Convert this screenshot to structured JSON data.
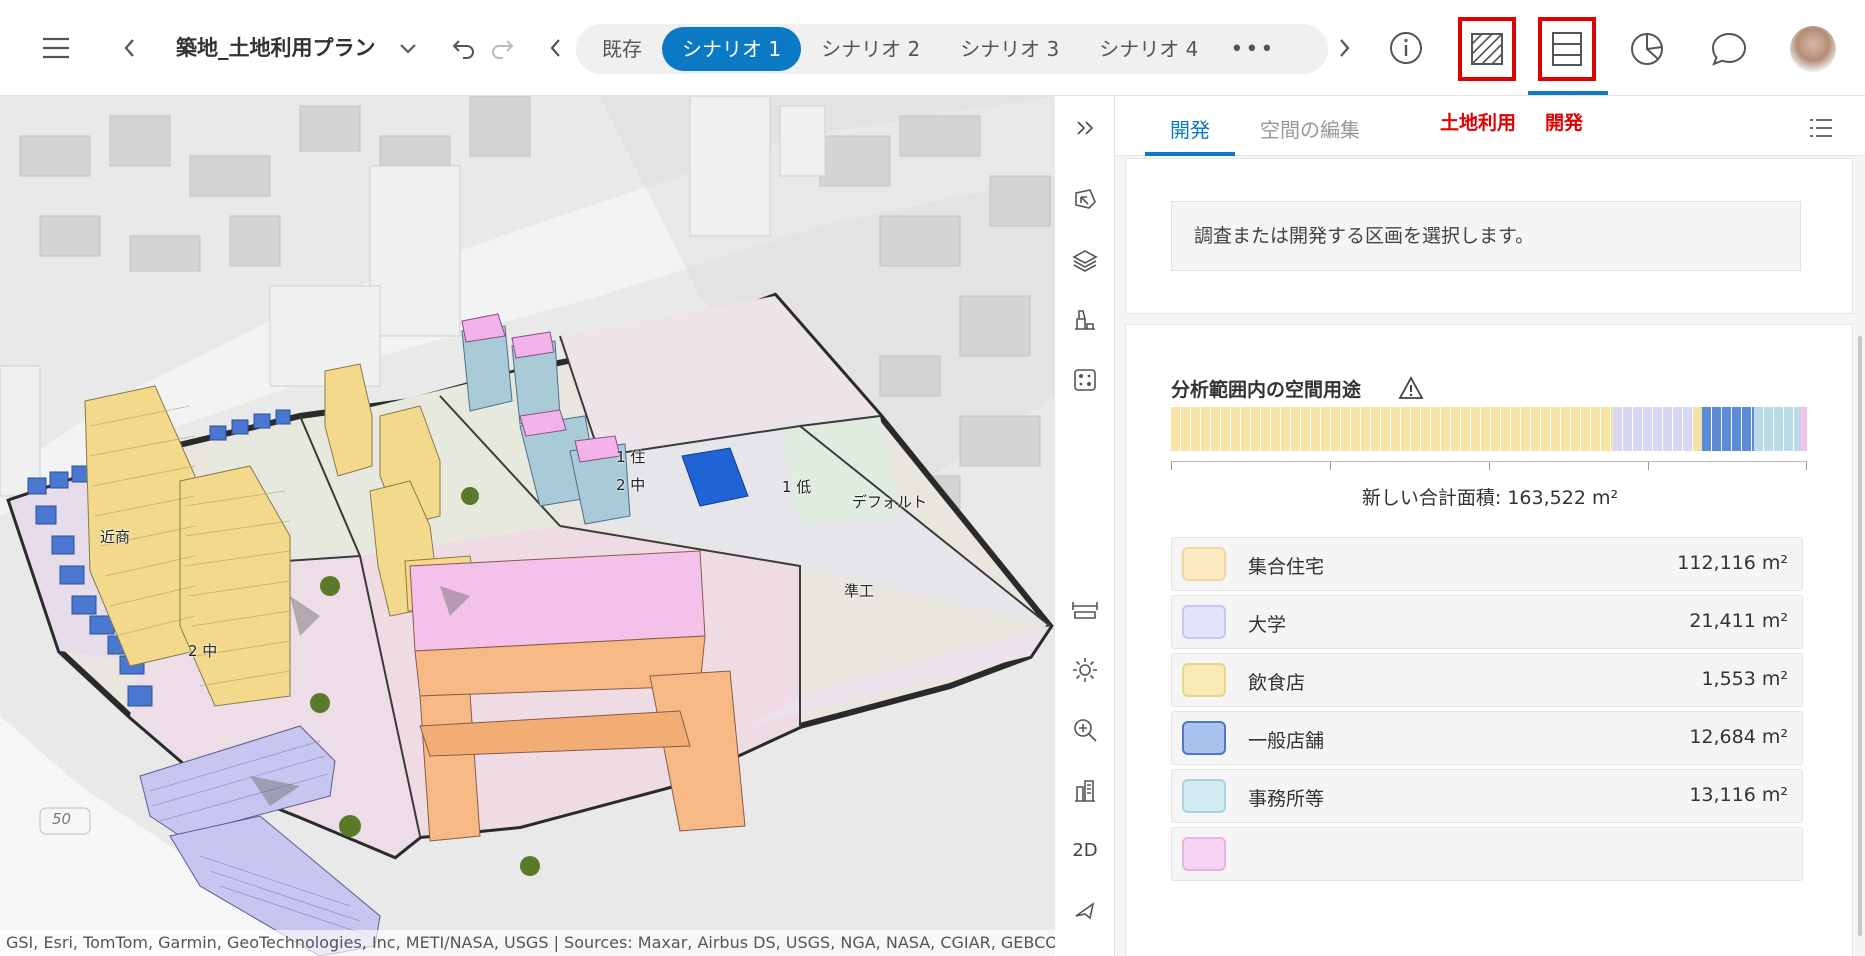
{
  "topbar": {
    "project_title": "築地_土地利用プラン",
    "scenarios": [
      "既存",
      "シナリオ 1",
      "シナリオ 2",
      "シナリオ 3",
      "シナリオ 4"
    ],
    "active_scenario": 1,
    "more_label": "•••"
  },
  "map": {
    "labels": {
      "kinsho": "近商",
      "nichu_a": "2 中",
      "nichu_b": "2 中",
      "ichiju": "1 住",
      "ichitei": "1 低",
      "default": "デフォルト",
      "junko": "準工",
      "road_50": "50"
    },
    "attribution": "GSI, Esri, TomTom, Garmin, GeoTechnologies, Inc, METI/NASA, USGS | Sources: Maxar, Airbus DS, USGS, NGA, NASA, CGIAR, GEBCO"
  },
  "toolstrip": {
    "mode_2d": "2D"
  },
  "panel": {
    "tab_develop": "開発",
    "tab_space_edit": "空間の編集",
    "annotation_landuse": "土地利用",
    "annotation_develop": "開発",
    "notice": "調査または開発する区画を選択します。",
    "analysis_title": "分析範囲内の空間用途",
    "total_label": "新しい合計面積: 163,522 m²",
    "colors": {
      "housing": "#f7e3a3",
      "university": "#d8d8f4",
      "restaurant": "#f4e2a8",
      "retail": "#5b8ad6",
      "office": "#b9dce6",
      "other": "#f2c3ec"
    },
    "legend": [
      {
        "name": "集合住宅",
        "value": "112,116 m²",
        "swatch": "#fbeac2",
        "border": "#efd9a0"
      },
      {
        "name": "大学",
        "value": "21,411 m²",
        "swatch": "#e3e3fb",
        "border": "#c6c6ee"
      },
      {
        "name": "飲食店",
        "value": "1,553 m²",
        "swatch": "#f8eab7",
        "border": "#e9d58e"
      },
      {
        "name": "一般店舗",
        "value": "12,684 m²",
        "swatch": "#a9c3ee",
        "border": "#4f78c4"
      },
      {
        "name": "事務所等",
        "value": "13,116 m²",
        "swatch": "#d2ebf1",
        "border": "#a9d2dc"
      }
    ]
  }
}
